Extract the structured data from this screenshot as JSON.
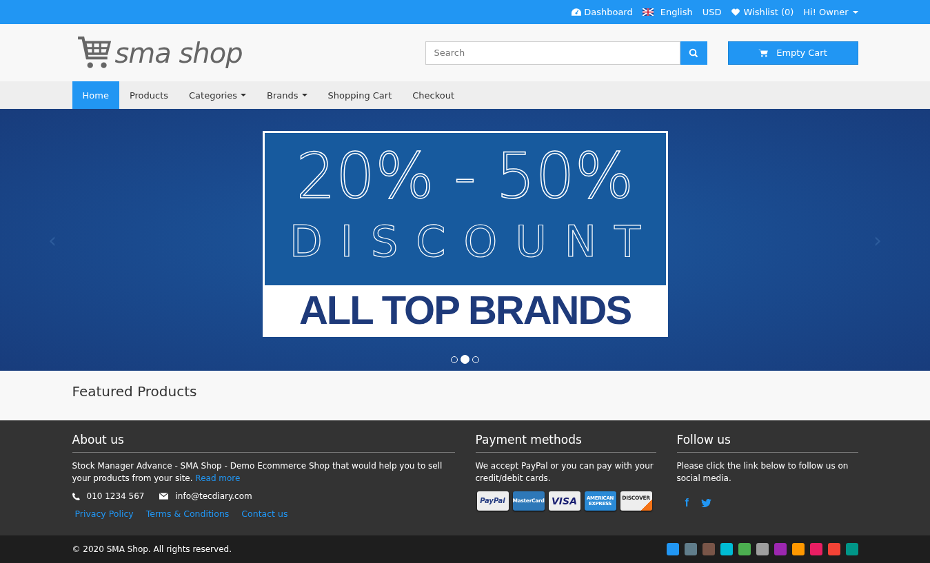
{
  "top_bar": {
    "links": [
      {
        "kind": "dashboard",
        "label": "Dashboard"
      },
      {
        "kind": "language",
        "label": "English"
      },
      {
        "kind": "currency",
        "label": "USD"
      },
      {
        "kind": "wishlist",
        "label": "Wishlist (0)"
      },
      {
        "kind": "account",
        "label": "Hi! Owner"
      }
    ]
  },
  "header": {
    "logo_text": "sma shop",
    "search": {
      "placeholder": "Search"
    },
    "cart_button": "Empty Cart"
  },
  "nav": [
    {
      "label": "Home",
      "selected": true,
      "dropdown": false
    },
    {
      "label": "Products",
      "selected": false,
      "dropdown": false
    },
    {
      "label": "Categories",
      "selected": false,
      "dropdown": true
    },
    {
      "label": "Brands",
      "selected": false,
      "dropdown": true
    },
    {
      "label": "Shopping Cart",
      "selected": false,
      "dropdown": false
    },
    {
      "label": "Checkout",
      "selected": false,
      "dropdown": false
    }
  ],
  "banner": {
    "prev_arrow": "‹",
    "next_arrow": "›",
    "line_1": "20% - 50%",
    "line_2": "DISCOUNT",
    "line_3": "ALL TOP BRANDS",
    "dots": [
      {
        "selected": false
      },
      {
        "selected": true
      },
      {
        "selected": false
      }
    ]
  },
  "featured": {
    "title": "Featured Products"
  },
  "footer": {
    "about": {
      "title": "About us",
      "text": "Stock Manager Advance - SMA Shop - Demo Ecommerce Shop that would help you to sell your products from your site.",
      "read_more": "Read more",
      "phone": "010 1234 567",
      "email": "info@tecdiary.com",
      "links": [
        "Privacy Policy",
        "Terms & Conditions",
        "Contact us"
      ]
    },
    "payment": {
      "title": "Payment methods",
      "text": "We accept PayPal or you can pay with your credit/debit cards.",
      "cards": [
        {
          "kind": "paypal",
          "label": "PayPal"
        },
        {
          "kind": "mastercard",
          "label": "MasterCard"
        },
        {
          "kind": "visa",
          "label": "VISA"
        },
        {
          "kind": "amex",
          "label": "AMERICAN EXPRESS"
        },
        {
          "kind": "discover",
          "label": "DISCOVER"
        }
      ]
    },
    "follow": {
      "title": "Follow us",
      "text": "Please click the link below to follow us on social media.",
      "social": [
        {
          "kind": "facebook",
          "label": "f"
        },
        {
          "kind": "twitter"
        }
      ]
    }
  },
  "bottom_bar": {
    "copyright": "© 2020 SMA Shop. All rights reserved.",
    "themes": [
      {
        "color": "#2196f3"
      },
      {
        "color": "#607d8b"
      },
      {
        "color": "#795548"
      },
      {
        "color": "#00bcd4"
      },
      {
        "color": "#4caf50"
      },
      {
        "color": "#9e9e9e"
      },
      {
        "color": "#9c27b0"
      },
      {
        "color": "#ff9800"
      },
      {
        "color": "#e91e63"
      },
      {
        "color": "#f44336"
      },
      {
        "color": "#009688"
      }
    ]
  }
}
